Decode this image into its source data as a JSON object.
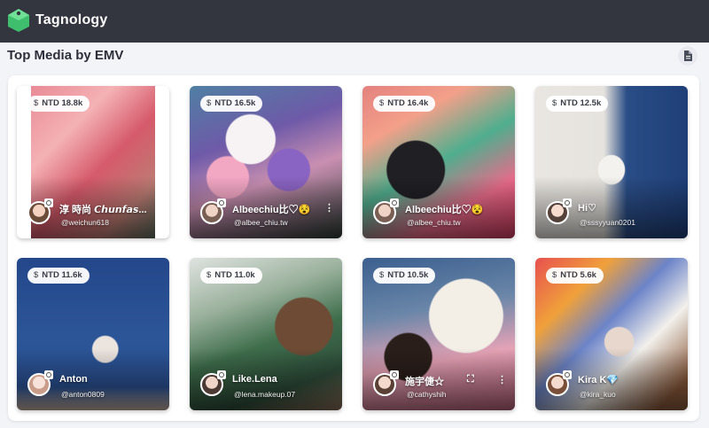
{
  "app": {
    "brand": "Tagnology"
  },
  "page": {
    "title": "Top Media by EMV"
  },
  "icons": {
    "logo": "tagnology-logo-icon",
    "export": "document-icon",
    "currency": "dollar-icon",
    "platform": "instagram-icon",
    "fullscreen": "fullscreen-icon",
    "more": "more-vert-icon"
  },
  "colors": {
    "topbar": "#33353f",
    "background": "#f3f4f8",
    "panel": "#ffffff",
    "logo": "#3fbf6e"
  },
  "cards": [
    {
      "emv": "NTD 18.8k",
      "name": "淳 時尚 𝘾𝙝𝙪𝙣𝙛𝙖𝙨...",
      "handle": "@weichun618"
    },
    {
      "emv": "NTD 16.5k",
      "name": "Albeechiu比♡😵",
      "handle": "@albee_chiu.tw"
    },
    {
      "emv": "NTD 16.4k",
      "name": "Albeechiu比♡😵",
      "handle": "@albee_chiu.tw"
    },
    {
      "emv": "NTD 12.5k",
      "name": "Hi♡",
      "handle": "@sssyyuan0201"
    },
    {
      "emv": "NTD 11.6k",
      "name": "Anton",
      "handle": "@anton0809"
    },
    {
      "emv": "NTD 11.0k",
      "name": "Like.Lena",
      "handle": "@lena.makeup.07"
    },
    {
      "emv": "NTD 10.5k",
      "name": "施宇倢☆",
      "handle": "@cathyshih"
    },
    {
      "emv": "NTD 5.6k",
      "name": "Kira K💎",
      "handle": "@kira_kuo"
    }
  ]
}
